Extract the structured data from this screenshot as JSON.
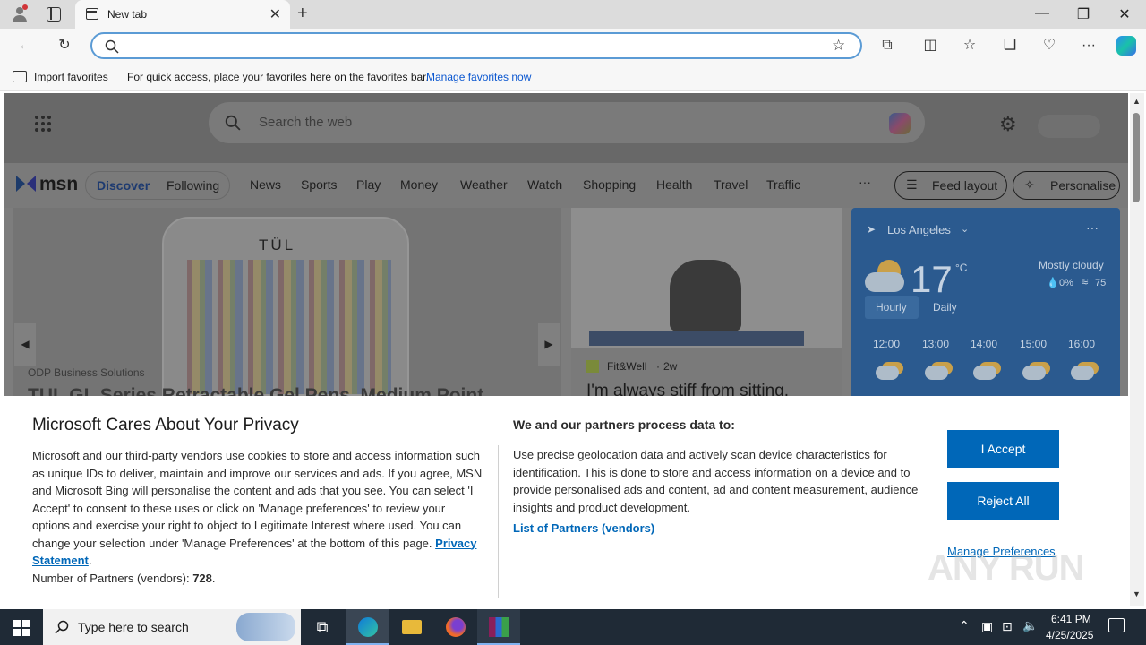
{
  "browser": {
    "tab_title": "New tab",
    "favorites_bar": {
      "import_label": "Import favorites",
      "hint": "For quick access, place your favorites here on the favorites bar.",
      "manage_link": "Manage favorites now"
    }
  },
  "msn": {
    "search_placeholder": "Search the web",
    "logo": "msn",
    "tabs": [
      "Discover",
      "Following"
    ],
    "nav": [
      "News",
      "Sports",
      "Play",
      "Money",
      "Weather",
      "Watch",
      "Shopping",
      "Health",
      "Travel",
      "Traffic"
    ],
    "more": "···",
    "feed_layout": "Feed layout",
    "personalise": "Personalise",
    "hero": {
      "brand_text": "TÜL",
      "source": "ODP Business Solutions",
      "headline": "TUL GL Series Retractable Gel Pens, Medium Point"
    },
    "article": {
      "source": "Fit&Well",
      "age": "2w",
      "headline": "I'm always stiff from sitting,"
    },
    "weather": {
      "location": "Los Angeles",
      "temp": "17",
      "unit": "°C",
      "condition": "Mostly cloudy",
      "precip": "0%",
      "aqi": "75",
      "tabs": [
        "Hourly",
        "Daily"
      ],
      "hours": [
        "12:00",
        "13:00",
        "14:00",
        "15:00",
        "16:00"
      ]
    }
  },
  "consent": {
    "title": "Microsoft Cares About Your Privacy",
    "body": "Microsoft and our third-party vendors use cookies to store and access information such as unique IDs to deliver, maintain and improve our services and ads. If you agree, MSN and Microsoft Bing will personalise the content and ads that you see. You can select 'I Accept' to consent to these uses or click on 'Manage preferences' to review your options and exercise your right to object to Legitimate Interest where used.  You can change your selection under 'Manage Preferences' at the bottom of this page.",
    "privacy_link": "Privacy Statement",
    "partners_count_label": "Number of Partners (vendors):",
    "partners_count": "728",
    "purposes_title": "We and our partners process data to:",
    "purposes_text": "Use precise geolocation data and actively scan device characteristics for identification. This is done to store and access information on a device and to provide personalised ads and content, ad and content measurement, audience insights and product development.",
    "partners_link": "List of Partners (vendors)",
    "accept": "I Accept",
    "reject": "Reject All",
    "manage": "Manage Preferences"
  },
  "taskbar": {
    "search_placeholder": "Type here to search",
    "time": "6:41 PM",
    "date": "4/25/2025"
  },
  "watermark": "ANY RUN"
}
